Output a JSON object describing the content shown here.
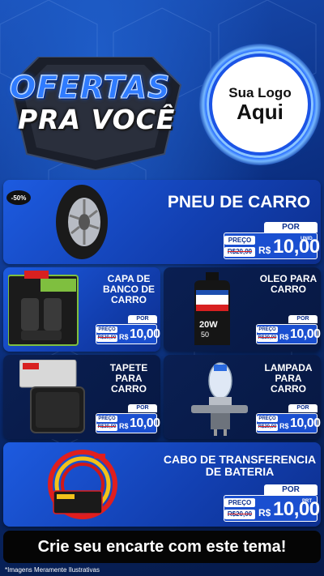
{
  "header": {
    "title_line1": "OFERTAS",
    "title_line2": "PRA VOCÊ",
    "logo_line1": "Sua Logo",
    "logo_line2": "Aqui"
  },
  "products": [
    {
      "title": "PNEU DE CARRO",
      "badge": "-50%",
      "por": "POR",
      "preco": "PREÇO",
      "old_price": "R$20,00",
      "currency": "R$",
      "price": "10,00",
      "unit": "UNID"
    },
    {
      "title": "CAPA DE BANCO DE CARRO",
      "por": "POR",
      "preco": "PREÇO",
      "old_price": "R$20,00",
      "currency": "R$",
      "price": "10,00",
      "unit": "UNID",
      "image_text": "CAPAS PARA BANCOS",
      "brand": "LUXCAR"
    },
    {
      "title": "OLEO PARA CARRO",
      "por": "POR",
      "preco": "PREÇO",
      "old_price": "R$20,00",
      "currency": "R$",
      "price": "10,00",
      "unit": "UNID",
      "image_text": "Mobil Super",
      "viscosity": "20W 50"
    },
    {
      "title": "TAPETE PARA CARRO",
      "por": "POR",
      "preco": "PREÇO",
      "old_price": "R$20,00",
      "currency": "R$",
      "price": "10,00",
      "unit": "UNID"
    },
    {
      "title": "LAMPADA PARA CARRO",
      "por": "POR",
      "preco": "PREÇO",
      "old_price": "R$20,00",
      "currency": "R$",
      "price": "10,00",
      "unit": "UNID"
    },
    {
      "title": "CABO DE TRANSFERENCIA DE BATERIA",
      "por": "POR",
      "preco": "PREÇO",
      "old_price": "R$20,00",
      "currency": "R$",
      "price": "10,00",
      "unit": "PRT",
      "image_text": "LUXCAR"
    }
  ],
  "footer": {
    "banner": "Crie seu encarte com este tema!",
    "disclaimer": "*Imagens Meramente Ilustrativas"
  },
  "colors": {
    "brand_blue": "#1d5be0",
    "dark_panel": "#0a1f52",
    "strike": "#e02020"
  }
}
